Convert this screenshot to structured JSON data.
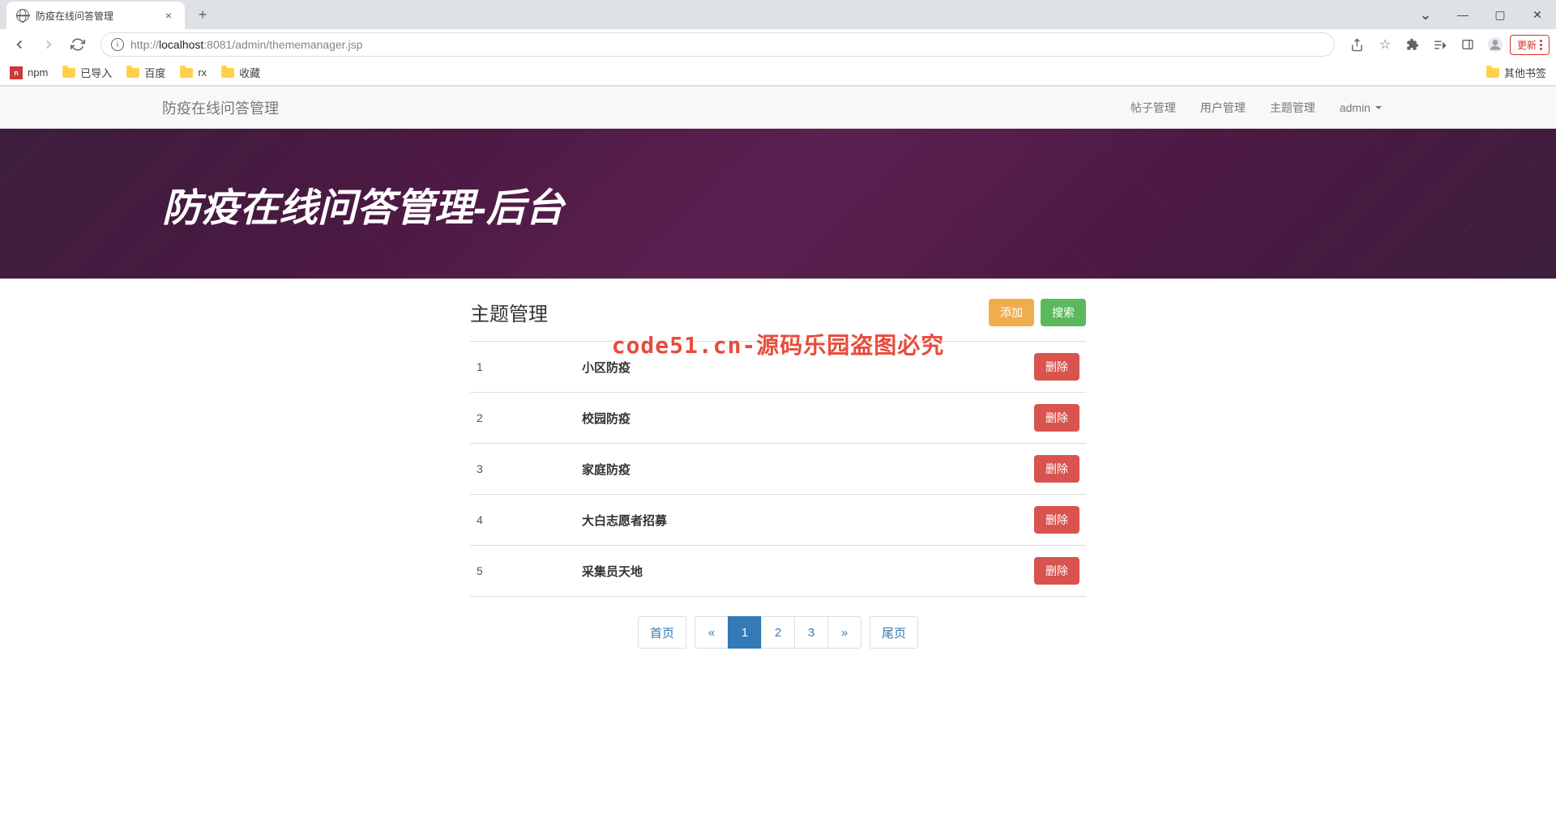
{
  "browser": {
    "tab_title": "防疫在线问答管理",
    "url_host": "localhost",
    "url_port": ":8081",
    "url_path": "/admin/thememanager.jsp",
    "url_prefix": "http://",
    "update_label": "更新",
    "bookmarks": [
      {
        "type": "npm",
        "label": "npm"
      },
      {
        "type": "folder",
        "label": "已导入"
      },
      {
        "type": "folder",
        "label": "百度"
      },
      {
        "type": "folder",
        "label": "rx"
      },
      {
        "type": "folder",
        "label": "收藏"
      }
    ],
    "other_bookmarks": "其他书签"
  },
  "navbar": {
    "brand": "防疫在线问答管理",
    "links": [
      "帖子管理",
      "用户管理",
      "主题管理"
    ],
    "user": "admin"
  },
  "hero": {
    "title": "防疫在线问答管理-后台"
  },
  "panel": {
    "title": "主题管理",
    "add_label": "添加",
    "search_label": "搜索",
    "delete_label": "删除",
    "rows": [
      {
        "idx": "1",
        "name": "小区防疫"
      },
      {
        "idx": "2",
        "name": "校园防疫"
      },
      {
        "idx": "3",
        "name": "家庭防疫"
      },
      {
        "idx": "4",
        "name": "大白志愿者招募"
      },
      {
        "idx": "5",
        "name": "采集员天地"
      }
    ]
  },
  "pagination": {
    "first": "首页",
    "last": "尾页",
    "pages": [
      "1",
      "2",
      "3"
    ],
    "active": "1"
  },
  "watermark": "code51.cn-源码乐园盗图必究"
}
